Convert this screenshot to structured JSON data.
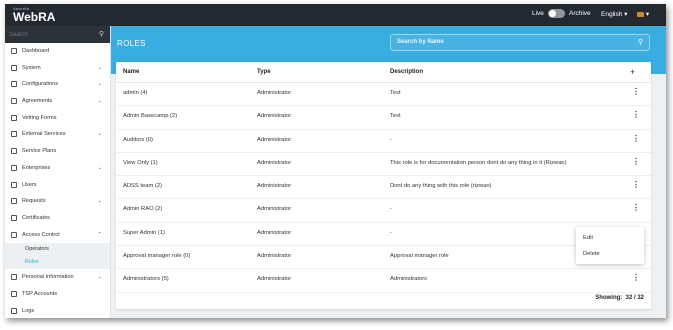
{
  "topbar": {
    "logo_small": "Ascertia",
    "logo_main": "WebRA",
    "live_label": "Live",
    "archive_label": "Archive",
    "language": "English ▾",
    "user_caret": "▾"
  },
  "sidebar": {
    "search_placeholder": "Search",
    "items": [
      {
        "label": "Dashboard",
        "icon": "dashboard-icon",
        "chevron": ""
      },
      {
        "label": "System",
        "icon": "system-icon",
        "chevron": "⌄"
      },
      {
        "label": "Configurations",
        "icon": "gear-icon",
        "chevron": "⌄"
      },
      {
        "label": "Agreements",
        "icon": "agreement-icon",
        "chevron": "⌄"
      },
      {
        "label": "Vetting Forms",
        "icon": "form-icon",
        "chevron": ""
      },
      {
        "label": "External Services",
        "icon": "services-icon",
        "chevron": "⌄"
      },
      {
        "label": "Service Plans",
        "icon": "plan-icon",
        "chevron": ""
      },
      {
        "label": "Enterprises",
        "icon": "enterprise-icon",
        "chevron": "⌄"
      },
      {
        "label": "Users",
        "icon": "user-icon",
        "chevron": ""
      },
      {
        "label": "Requests",
        "icon": "request-icon",
        "chevron": "⌄"
      },
      {
        "label": "Certificates",
        "icon": "certificate-icon",
        "chevron": ""
      },
      {
        "label": "Access Control",
        "icon": "lock-icon",
        "chevron": "⌃"
      }
    ],
    "sub_items": [
      {
        "label": "Operators",
        "active": false
      },
      {
        "label": "Roles",
        "active": true
      }
    ],
    "items_after": [
      {
        "label": "Personal Information",
        "icon": "id-card-icon",
        "chevron": "⌄"
      },
      {
        "label": "TSP Accounts",
        "icon": "account-icon",
        "chevron": ""
      },
      {
        "label": "Logs",
        "icon": "log-icon",
        "chevron": ""
      }
    ]
  },
  "header": {
    "title": "ROLES",
    "search_placeholder": "Search by Name"
  },
  "table": {
    "columns": [
      "Name",
      "Type",
      "Description"
    ],
    "add_symbol": "+",
    "rows": [
      {
        "name": "admin (4)",
        "type": "Administrator",
        "description": "Test"
      },
      {
        "name": "Admin Basecamp (2)",
        "type": "Administrator",
        "description": "Test"
      },
      {
        "name": "Auditors (0)",
        "type": "Administrator",
        "description": "-"
      },
      {
        "name": "View Only (1)",
        "type": "Administrator",
        "description": "This role is for documentation person dont do any thing in it (Rizwan)"
      },
      {
        "name": "ADSS team (2)",
        "type": "Administrator",
        "description": "Dont do any thing with this role (rizwan)"
      },
      {
        "name": "Admin RAO (2)",
        "type": "Administrator",
        "description": "-"
      },
      {
        "name": "Super Admin (1)",
        "type": "Administrator",
        "description": "-"
      },
      {
        "name": "Approval manager role (0)",
        "type": "Administrator",
        "description": "Approval manager role"
      },
      {
        "name": "Administrators (5)",
        "type": "Administrator",
        "description": "Administrators"
      }
    ],
    "kebab": "⋮",
    "showing_label": "Showing:",
    "showing_value": "32 / 32"
  },
  "context_menu": {
    "edit": "Edit",
    "delete": "Delete"
  },
  "colors": {
    "topbar": "#222a30",
    "accent": "#39ace0",
    "active_link": "#2aa7de"
  }
}
